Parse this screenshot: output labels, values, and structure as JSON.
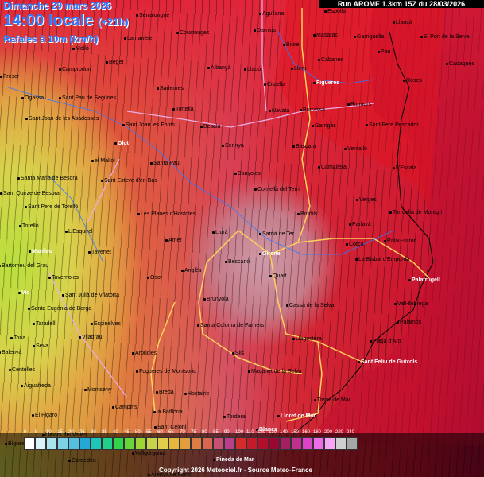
{
  "header": {
    "date": "Dimanche 29 mars 2026",
    "time": "14:00 locale",
    "offset": "(+21h)",
    "variable": "Rafales à 10m (km/h)",
    "run": "Run AROME 1.3km 15Z du 28/03/2026"
  },
  "legend": {
    "labels": [
      "0",
      "5",
      "10",
      "15",
      "20",
      "25",
      "30",
      "35",
      "40",
      "45",
      "50",
      "55",
      "60",
      "65",
      "70",
      "75",
      "80",
      "85",
      "90",
      "100",
      "110",
      "120",
      "130",
      "140",
      "150",
      "160",
      "180",
      "200",
      "220",
      "240"
    ],
    "colors": [
      "#ffffff",
      "#d9f2f6",
      "#a9e4ee",
      "#7fd1e6",
      "#55bfe0",
      "#25a8d6",
      "#1ec6b7",
      "#1fcf8a",
      "#31d44a",
      "#67d43a",
      "#9fd336",
      "#c8d34c",
      "#e2cd4a",
      "#e4b83e",
      "#e39d3e",
      "#dd7d44",
      "#d8664f",
      "#c95072",
      "#bb3e8b",
      "#d42b2b",
      "#c41a2a",
      "#b0102c",
      "#9a0732",
      "#a22060",
      "#c02f8e",
      "#dc43c7",
      "#ef6ce8",
      "#f7a6f5",
      "#cfcfcf",
      "#a6a6a6"
    ]
  },
  "towns": [
    {
      "name": "Serralongue"
    },
    {
      "name": "Agullana"
    },
    {
      "name": "Espolla"
    },
    {
      "name": "Llançà"
    },
    {
      "name": "Molló"
    },
    {
      "name": "Lamanère"
    },
    {
      "name": "Coustouges"
    },
    {
      "name": "Darnius"
    },
    {
      "name": "Masarac"
    },
    {
      "name": "Garriguella"
    },
    {
      "name": "El Port de la Selva"
    },
    {
      "name": "Biure"
    },
    {
      "name": "Pau"
    },
    {
      "name": "Camprodon"
    },
    {
      "name": "Beget"
    },
    {
      "name": "Albanyà"
    },
    {
      "name": "Cabanes"
    },
    {
      "name": "Cadaqués"
    },
    {
      "name": "Lladó"
    },
    {
      "name": "Llers"
    },
    {
      "name": "Freser"
    },
    {
      "name": "Sadernes"
    },
    {
      "name": "Cistella"
    },
    {
      "name": "Figueres"
    },
    {
      "name": "Roses"
    },
    {
      "name": "Ogassa"
    },
    {
      "name": "Sant Pau de Segúries"
    },
    {
      "name": "Tortellà"
    },
    {
      "name": "Navata"
    },
    {
      "name": "Borrassà"
    },
    {
      "name": "Riumors"
    },
    {
      "name": "Sant Joan de les Abadesses"
    },
    {
      "name": "Sant Joan les Fonts"
    },
    {
      "name": "Besalú"
    },
    {
      "name": "Garrigàs"
    },
    {
      "name": "Sant Pere Pescador"
    },
    {
      "name": "Olot"
    },
    {
      "name": "Serinyà"
    },
    {
      "name": "Bàscara"
    },
    {
      "name": "Ventalló"
    },
    {
      "name": "el Mallol"
    },
    {
      "name": "Santa Pau"
    },
    {
      "name": "Camallera"
    },
    {
      "name": "Banyoles"
    },
    {
      "name": "L'Escala"
    },
    {
      "name": "Santa Maria de Besora"
    },
    {
      "name": "Sant Esteve d'en Bas"
    },
    {
      "name": "Cornellà del Terri"
    },
    {
      "name": "Sant Quirze de Besora"
    },
    {
      "name": "Verges"
    },
    {
      "name": "Sant Pere de Torelló"
    },
    {
      "name": "Les Planes d'Hostoles"
    },
    {
      "name": "Bordils"
    },
    {
      "name": "Torroella de Montgrí"
    },
    {
      "name": "Torelló"
    },
    {
      "name": "Parlavà"
    },
    {
      "name": "L'Esquirol"
    },
    {
      "name": "Llorà"
    },
    {
      "name": "Sarrià de Ter"
    },
    {
      "name": "Amer"
    },
    {
      "name": "Palau-sator"
    },
    {
      "name": "Corçà"
    },
    {
      "name": "Manlleu"
    },
    {
      "name": "Tavertet"
    },
    {
      "name": "Girone"
    },
    {
      "name": "La Bisbal d'Empordà"
    },
    {
      "name": "Bartomeu del Grau"
    },
    {
      "name": "Bescanó"
    },
    {
      "name": "Anglès"
    },
    {
      "name": "Quart"
    },
    {
      "name": "Tavernoles"
    },
    {
      "name": "Osor"
    },
    {
      "name": "Palafrugell"
    },
    {
      "name": "Vic"
    },
    {
      "name": "Sant Julià de Vilatorta"
    },
    {
      "name": "Brunyola"
    },
    {
      "name": "Vall-llobrega"
    },
    {
      "name": "Santa Eugènia de Berga"
    },
    {
      "name": "Cassà de la Selva"
    },
    {
      "name": "Taradell"
    },
    {
      "name": "Espinelves"
    },
    {
      "name": "Santa Coloma de Farners"
    },
    {
      "name": "Palamós"
    },
    {
      "name": "Viladrau"
    },
    {
      "name": "Llagostera"
    },
    {
      "name": "Tona"
    },
    {
      "name": "Platja d'Aro"
    },
    {
      "name": "Seva"
    },
    {
      "name": "Arbúcies"
    },
    {
      "name": "Sils"
    },
    {
      "name": "Balenyà"
    },
    {
      "name": "Sant Feliu de Guíxols"
    },
    {
      "name": "Centelles"
    },
    {
      "name": "Fogueres de Montsoriu"
    },
    {
      "name": "Maçanet de la Selva"
    },
    {
      "name": "Aiguafreda"
    },
    {
      "name": "Montseny"
    },
    {
      "name": "Breda"
    },
    {
      "name": "Hostalric"
    },
    {
      "name": "Tossa de Mar"
    },
    {
      "name": "Campins"
    },
    {
      "name": "la Batllòria"
    },
    {
      "name": "El Figaró"
    },
    {
      "name": "Tordera"
    },
    {
      "name": "Lloret de Mar"
    },
    {
      "name": "Sant Celoni"
    },
    {
      "name": "Blanes"
    },
    {
      "name": "Llinars del Vallès"
    },
    {
      "name": "Vallgorguina"
    },
    {
      "name": "Pineda de Mar"
    },
    {
      "name": "Cardedeu"
    },
    {
      "name": "Arenys de Munt"
    },
    {
      "name": "Bigues"
    }
  ],
  "copyright": "Copyright 2026 Meteociel.fr - Source Meteo-France"
}
